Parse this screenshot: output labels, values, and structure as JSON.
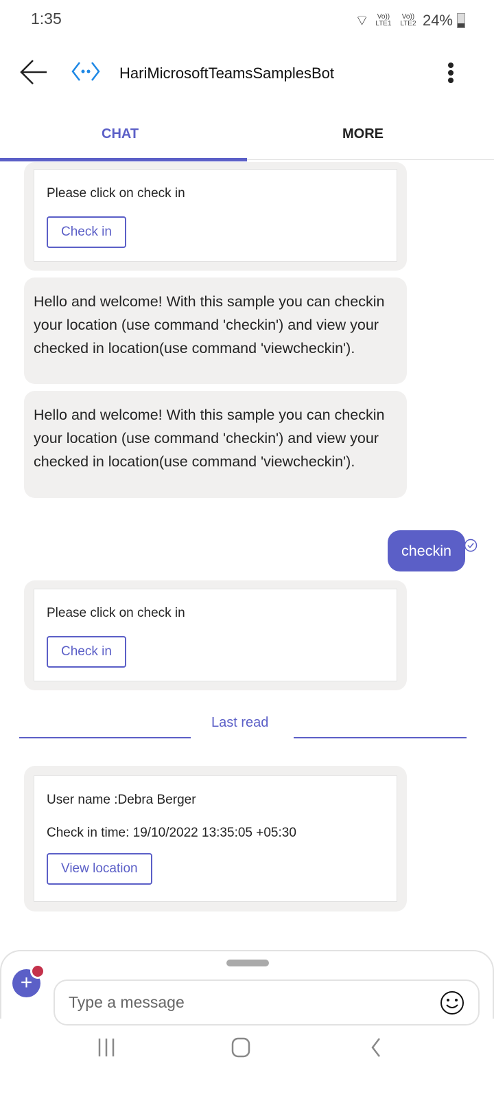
{
  "status_bar": {
    "time": "1:35",
    "network1": "Vo)) LTE1",
    "network2": "Vo)) LTE2",
    "battery": "24%"
  },
  "header": {
    "title": "HariMicrosoftTeamsSamplesBot"
  },
  "tabs": [
    {
      "label": "CHAT",
      "selected": true
    },
    {
      "label": "MORE",
      "selected": false
    }
  ],
  "accent": "#5b5fc7",
  "messages": [
    {
      "type": "card",
      "text": "Please click on check in",
      "button": "Check in"
    },
    {
      "type": "text",
      "text": "Hello and welcome! With this sample you can checkin your location (use command 'checkin') and view your checked in location(use command 'viewcheckin')."
    },
    {
      "type": "text",
      "text": "Hello and welcome! With this sample you can checkin your location (use command 'checkin') and view your checked in location(use command 'viewcheckin')."
    },
    {
      "type": "sent",
      "text": "checkin"
    },
    {
      "type": "card",
      "text": "Please click on check in",
      "button": "Check in"
    },
    {
      "type": "card",
      "line1": "User name :Debra Berger",
      "line2": "Check in time: 19/10/2022 13:35:05 +05:30",
      "button": "View location"
    }
  ],
  "last_read": "Last read",
  "composer": {
    "placeholder": "Type a message"
  }
}
